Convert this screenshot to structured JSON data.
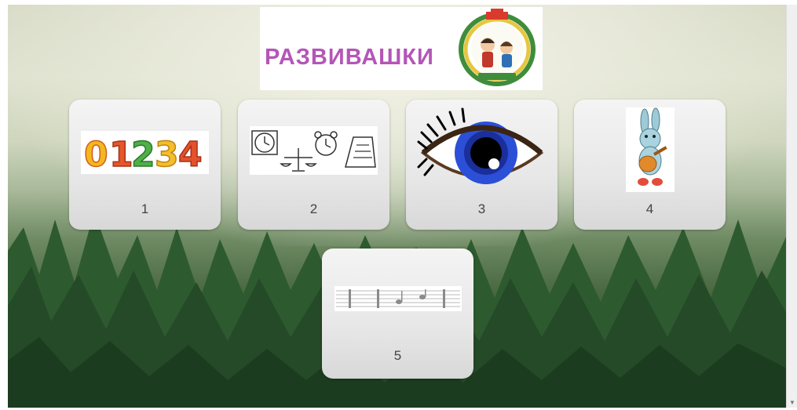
{
  "banner": {
    "title": "РАЗВИВАШКИ",
    "icon": "kids-wreath-emblem-icon"
  },
  "tiles": [
    {
      "label": "1",
      "icon": "numbers-01234-icon"
    },
    {
      "label": "2",
      "icon": "clock-scales-alarm-icon"
    },
    {
      "label": "3",
      "icon": "blue-eye-icon"
    },
    {
      "label": "4",
      "icon": "bunny-guitar-icon"
    },
    {
      "label": "5",
      "icon": "musical-staff-icon"
    }
  ],
  "colors": {
    "title": "#b455b8",
    "tile_bg": "#e7e7e7",
    "forest_dark": "#2f4f2c"
  }
}
